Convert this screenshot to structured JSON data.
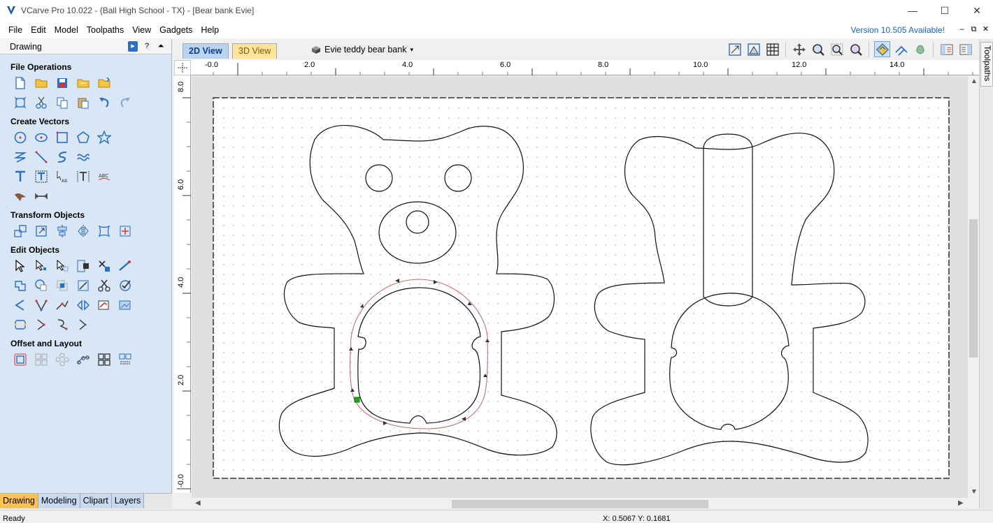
{
  "window": {
    "title": "VCarve Pro 10.022 - {Ball High School - TX} - [Bear bank Evie]",
    "minimize": "—",
    "maximize": "☐",
    "close": "✕"
  },
  "menu": {
    "items": [
      "File",
      "Edit",
      "Model",
      "Toolpaths",
      "View",
      "Gadgets",
      "Help"
    ],
    "version_notice": "Version 10.505 Available!"
  },
  "left_panel": {
    "title": "Drawing",
    "sections": {
      "file_operations": "File Operations",
      "create_vectors": "Create Vectors",
      "transform_objects": "Transform Objects",
      "edit_objects": "Edit Objects",
      "offset_layout": "Offset and Layout"
    },
    "tabs": [
      "Drawing",
      "Modeling",
      "Clipart",
      "Layers"
    ]
  },
  "toolbar": {
    "tab_2d": "2D View",
    "tab_3d": "3D View",
    "document": "Evie teddy bear bank"
  },
  "right_strip": {
    "label": "Toolpaths"
  },
  "ruler": {
    "h_labels": [
      "-0.0",
      "2.0",
      "4.0",
      "6.0",
      "8.0",
      "10.0",
      "12.0",
      "14.0"
    ],
    "v_labels": [
      "8.0",
      "6.0",
      "4.0",
      "2.0",
      "-0.0"
    ]
  },
  "status": {
    "text": "Ready",
    "coords": "X: 0.5067 Y: 0.1681"
  },
  "colors": {
    "panel_bg": "#d8e6f6",
    "selected_vector": "#c07070",
    "active_tab": "#ffc24a",
    "link": "#1565c0"
  }
}
